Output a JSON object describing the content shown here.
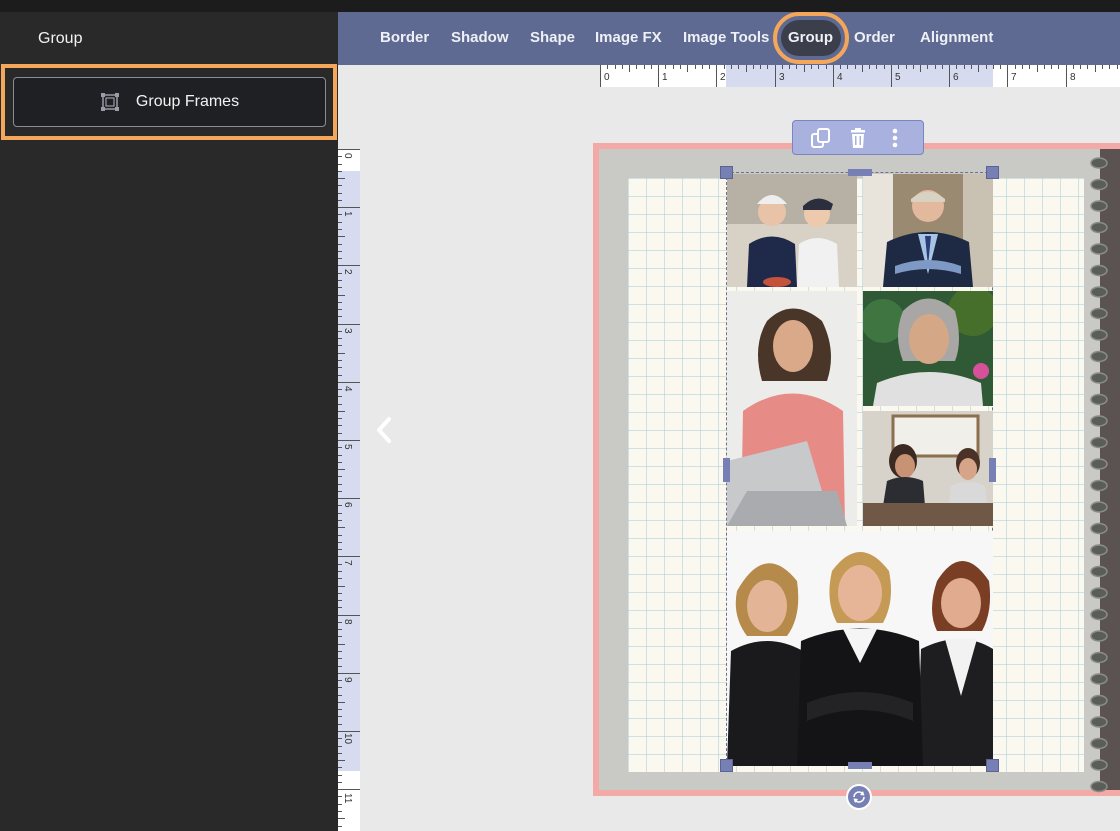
{
  "sidebar": {
    "title": "Group",
    "group_frames_label": "Group Frames"
  },
  "toolbar": {
    "items": [
      "Border",
      "Shadow",
      "Shape",
      "Image FX",
      "Image Tools",
      "Group",
      "Order",
      "Alignment"
    ],
    "active": "Group"
  },
  "rulers": {
    "top_labels": [
      "0",
      "1",
      "2",
      "3",
      "4",
      "5",
      "6",
      "7",
      "8"
    ],
    "left_labels": [
      "0",
      "1",
      "2",
      "3",
      "4",
      "5",
      "6",
      "7",
      "8",
      "9",
      "10",
      "11"
    ]
  },
  "floating_toolbar": {
    "icons": [
      "duplicate-icon",
      "trash-icon",
      "more-vertical-icon"
    ]
  },
  "colors": {
    "toolbar_bg": "#5f6a92",
    "highlight_orange": "#f4a75a",
    "selection_handle": "#7680b4",
    "page_border": "#f3a9a6"
  }
}
